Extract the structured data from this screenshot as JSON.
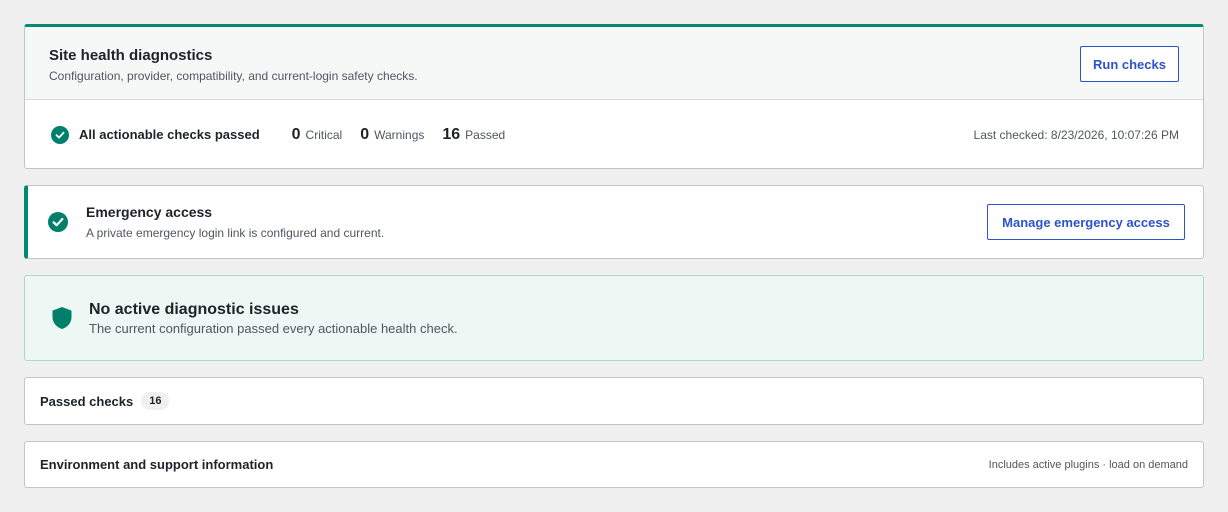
{
  "header": {
    "title": "Site health diagnostics",
    "subtitle": "Configuration, provider, compatibility, and current-login safety checks.",
    "run_button": "Run checks"
  },
  "summary": {
    "status": "All actionable checks passed",
    "critical_count": "0",
    "critical_label": "Critical",
    "warnings_count": "0",
    "warnings_label": "Warnings",
    "passed_count": "16",
    "passed_label": "Passed",
    "last_checked": "Last checked: 8/23/2026, 10:07:26 PM"
  },
  "emergency": {
    "title": "Emergency access",
    "subtitle": "A private emergency login link is configured and current.",
    "button": "Manage emergency access"
  },
  "no_issues": {
    "title": "No active diagnostic issues",
    "subtitle": "The current configuration passed every actionable health check."
  },
  "passed_checks": {
    "title": "Passed checks",
    "count": "16"
  },
  "environment": {
    "title": "Environment and support information",
    "meta": "Includes active plugins · load on demand"
  },
  "colors": {
    "accent_green": "#008a73",
    "button_blue": "#2c54c8",
    "success_bg": "#edf7f4"
  },
  "icons": {
    "summary_status": "check-circle-icon",
    "emergency_status": "check-circle-icon",
    "no_issues": "shield-icon"
  }
}
